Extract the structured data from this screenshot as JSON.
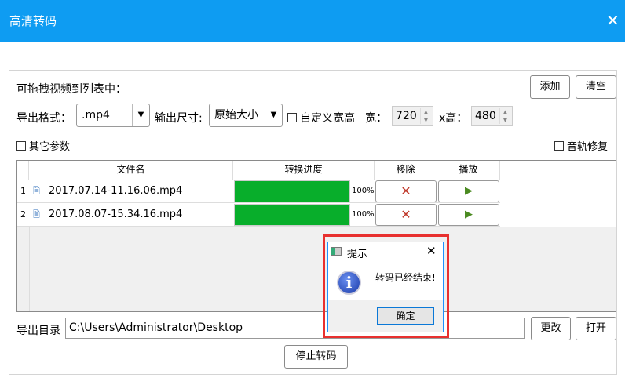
{
  "window": {
    "title": "高清转码"
  },
  "toolbar": {
    "drag_hint": "可拖拽视频到列表中：",
    "add_label": "添加",
    "clear_label": "清空"
  },
  "format": {
    "label": "导出格式：",
    "value": ".mp4"
  },
  "size": {
    "label": "输出尺寸:",
    "value": "原始大小"
  },
  "custom": {
    "label": "自定义宽高",
    "width_label": "宽：",
    "width_value": "720",
    "height_label": "x高：",
    "height_value": "480"
  },
  "other_params": {
    "label": "其它参数"
  },
  "audio_fix": {
    "label": "音轨修复"
  },
  "table": {
    "headers": [
      "文件名",
      "转换进度",
      "移除",
      "播放"
    ],
    "rows": [
      {
        "num": "1",
        "name": "2017.07.14-11.16.06.mp4",
        "progress": 100,
        "progress_text": "100%"
      },
      {
        "num": "2",
        "name": "2017.08.07-15.34.16.mp4",
        "progress": 100,
        "progress_text": "100%"
      }
    ]
  },
  "output": {
    "label": "导出目录",
    "path": "C:\\Users\\Administrator\\Desktop",
    "change_label": "更改",
    "open_label": "打开"
  },
  "stop_label": "停止转码",
  "dialog": {
    "title": "提示",
    "message": "转码已经结束!",
    "ok_label": "确定"
  },
  "colors": {
    "titlebar": "#0e9cf2",
    "progress": "#08ae2b",
    "highlight": "#e8302f"
  }
}
